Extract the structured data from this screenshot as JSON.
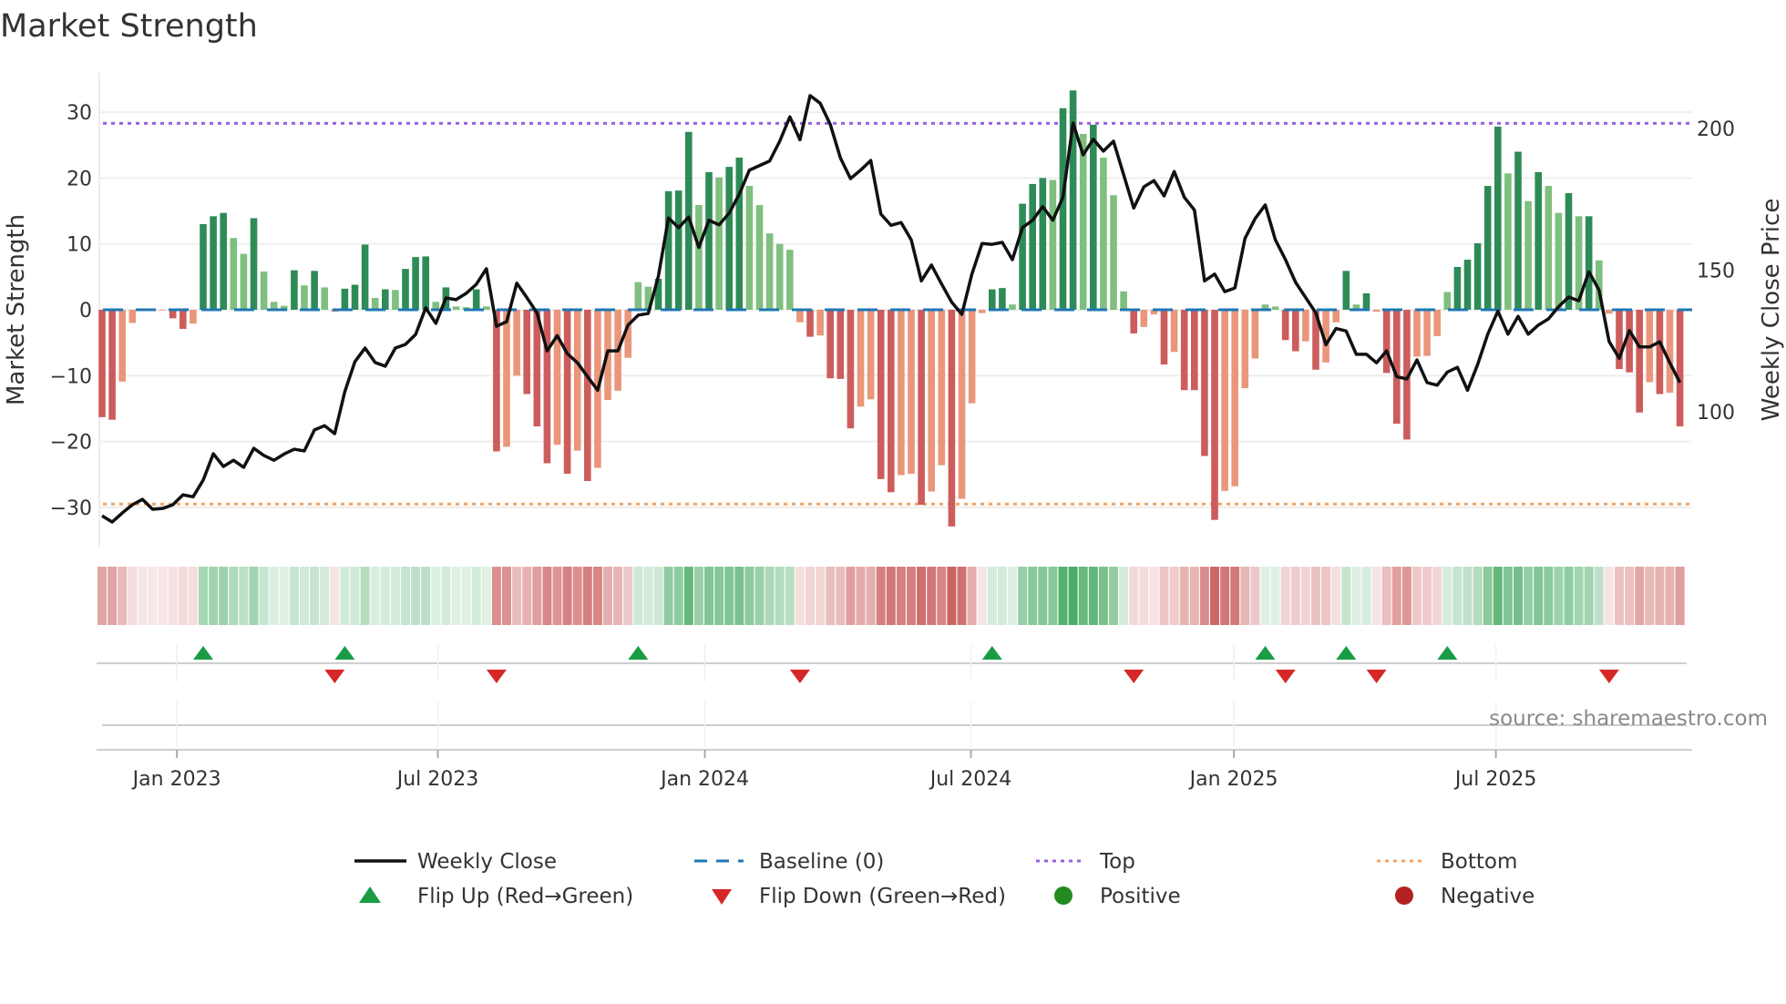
{
  "chart_data": {
    "type": "bar+line",
    "title": "Market Strength",
    "ylabel": "Market Strength",
    "y2label": "Weekly Close Price",
    "ylim": [
      -36,
      36
    ],
    "y2_ticks": [
      "100",
      "150",
      "200"
    ],
    "y_ticks": [
      "30",
      "20",
      "10",
      "0",
      "−10",
      "−20",
      "−30"
    ],
    "y_tick_values": [
      30,
      20,
      10,
      0,
      -10,
      -20,
      -30
    ],
    "y2_tick_values": [
      100,
      150,
      200
    ],
    "top_level": 28.3,
    "bottom_level": -29.5,
    "baseline": 0,
    "x_ticks": [
      {
        "label": "Jan 2023",
        "week": 8.4
      },
      {
        "label": "Jul 2023",
        "week": 34.2
      },
      {
        "label": "Jan 2024",
        "week": 60.6
      },
      {
        "label": "Jul 2024",
        "week": 86.9
      },
      {
        "label": "Jan 2025",
        "week": 112.9
      },
      {
        "label": "Jul 2025",
        "week": 138.8
      }
    ],
    "strength": [
      -16.3,
      -16.7,
      -10.9,
      -2.0,
      -0.2,
      -0.2,
      -0.1,
      -1.3,
      -2.9,
      -2.1,
      13.0,
      14.2,
      14.7,
      10.9,
      8.5,
      13.9,
      5.8,
      1.2,
      0.6,
      6.0,
      3.7,
      5.9,
      3.4,
      -0.3,
      3.2,
      3.8,
      9.9,
      1.8,
      3.1,
      3.0,
      6.2,
      8.0,
      8.1,
      1.2,
      3.4,
      0.5,
      0.4,
      3.1,
      0.5,
      -21.5,
      -20.8,
      -10.0,
      -12.8,
      -17.7,
      -23.3,
      -20.5,
      -24.9,
      -21.4,
      -26.0,
      -24.0,
      -13.7,
      -12.3,
      -7.3,
      4.2,
      3.5,
      4.7,
      18.0,
      18.1,
      27.0,
      15.9,
      20.9,
      20.1,
      21.7,
      23.1,
      18.8,
      15.9,
      11.6,
      10.0,
      9.1,
      -1.9,
      -4.1,
      -3.9,
      -10.4,
      -10.5,
      -18.0,
      -14.7,
      -13.6,
      -25.7,
      -27.7,
      -25.1,
      -24.9,
      -29.6,
      -27.6,
      -23.6,
      -32.9,
      -28.7,
      -14.2,
      -0.5,
      3.1,
      3.3,
      0.8,
      16.1,
      19.1,
      20.0,
      19.7,
      30.6,
      33.3,
      26.7,
      28.1,
      23.1,
      17.4,
      2.8,
      -3.6,
      -2.6,
      -0.7,
      -8.3,
      -6.4,
      -12.2,
      -12.2,
      -22.2,
      -31.9,
      -27.5,
      -26.8,
      -11.9,
      -7.4,
      0.8,
      0.5,
      -4.6,
      -6.3,
      -4.8,
      -9.1,
      -8.0,
      -1.9,
      5.9,
      0.8,
      2.5,
      -0.3,
      -9.6,
      -17.3,
      -19.7,
      -7.1,
      -7.0,
      -4.0,
      2.7,
      6.5,
      7.6,
      10.1,
      18.8,
      27.8,
      20.7,
      24.0,
      16.5,
      20.9,
      18.8,
      14.7,
      17.7,
      14.2,
      14.2,
      7.5,
      -0.6,
      -9.0,
      -9.5,
      -15.6,
      -11.0,
      -12.8,
      -12.6,
      -17.7
    ],
    "weekly_close": [
      63.3,
      61.1,
      64.3,
      67.2,
      69.1,
      65.6,
      65.9,
      67.2,
      70.7,
      70.0,
      75.9,
      85.2,
      80.7,
      82.9,
      80.4,
      87.1,
      84.6,
      82.9,
      85.1,
      86.8,
      86.2,
      93.6,
      95.1,
      92.3,
      107.1,
      117.7,
      122.5,
      117.4,
      116.1,
      122.5,
      123.8,
      127.3,
      136.7,
      131.2,
      140.2,
      139.6,
      141.8,
      145.0,
      150.5,
      130.2,
      131.8,
      145.4,
      140.3,
      134.9,
      121.5,
      126.9,
      120.5,
      117.3,
      112.4,
      107.6,
      121.5,
      121.5,
      130.6,
      134.1,
      134.7,
      147.8,
      168.4,
      165.0,
      168.7,
      158.0,
      167.6,
      166.0,
      170.1,
      176.8,
      185.3,
      186.9,
      188.5,
      195.5,
      204.1,
      196.0,
      211.6,
      208.9,
      201.4,
      189.6,
      182.3,
      185.3,
      188.7,
      169.8,
      165.8,
      166.8,
      160.7,
      146.2,
      151.8,
      145.1,
      138.7,
      134.4,
      148.6,
      159.4,
      159.1,
      159.8,
      153.7,
      165.0,
      167.6,
      172.4,
      167.6,
      175.7,
      201.9,
      190.7,
      196.2,
      192.0,
      195.5,
      183.7,
      171.9,
      179.4,
      181.6,
      176.2,
      184.8,
      175.7,
      171.2,
      146.2,
      148.6,
      142.4,
      143.7,
      161.2,
      168.2,
      173.0,
      160.7,
      153.7,
      145.7,
      140.3,
      134.9,
      123.7,
      129.4,
      128.5,
      120.3,
      120.3,
      117.3,
      121.5,
      112.4,
      111.6,
      118.3,
      110.3,
      109.4,
      114.0,
      115.7,
      107.6,
      116.7,
      127.4,
      135.5,
      127.4,
      133.7,
      127.4,
      130.6,
      132.8,
      137.1,
      140.5,
      139.2,
      149.4,
      143.0,
      124.8,
      118.9,
      128.7,
      122.9,
      122.9,
      124.7,
      117.3,
      110.3
    ],
    "flip_up_weeks": [
      11,
      25,
      54,
      89,
      116,
      124,
      134
    ],
    "flip_down_weeks": [
      24,
      40,
      70,
      103,
      118,
      127,
      150
    ],
    "legend": {
      "weekly_close": "Weekly Close",
      "baseline": "Baseline (0)",
      "top": "Top",
      "bottom": "Bottom",
      "flip_up": "Flip Up (Red→Green)",
      "flip_down": "Flip Down (Green→Red)",
      "positive": "Positive",
      "negative": "Negative"
    },
    "legend_placement": "bottom",
    "source": "source: sharemaestro.com",
    "colors": {
      "green_dark": "#2e8b57",
      "green_light": "#7fbf7f",
      "red_dark": "#cd5c5c",
      "red_light": "#e9967a",
      "top": "#9b5de5",
      "bottom": "#f4a460",
      "baseline": "#1f77b4",
      "flip_up": "#1a9c45",
      "flip_down": "#d62728",
      "positive": "#228b22",
      "negative": "#b22222",
      "line": "#111111"
    }
  }
}
